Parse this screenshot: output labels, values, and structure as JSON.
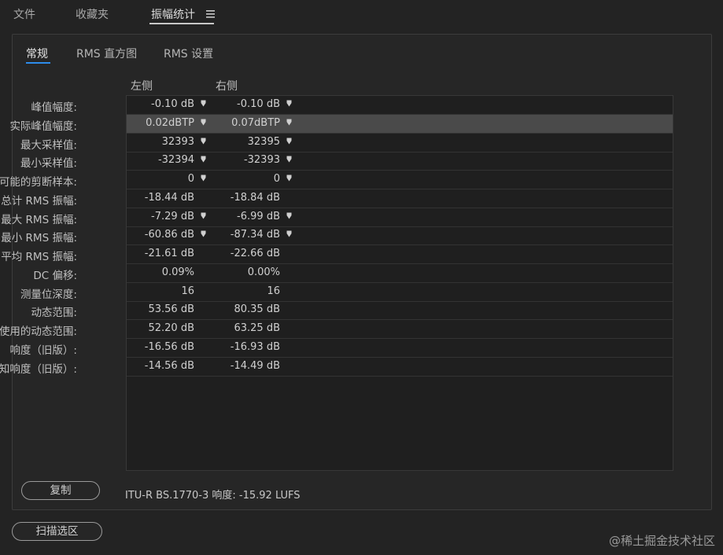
{
  "top_tabs": [
    {
      "label": "文件"
    },
    {
      "label": "收藏夹"
    },
    {
      "label": "振幅统计"
    }
  ],
  "menu_icon": "hamburger-menu-icon",
  "sub_tabs": [
    {
      "label": "常规"
    },
    {
      "label": "RMS 直方图"
    },
    {
      "label": "RMS 设置"
    }
  ],
  "columns": {
    "left": "左侧",
    "right": "右侧"
  },
  "rows": [
    {
      "label": "峰值幅度:",
      "left": "-0.10 dB",
      "right": "-0.10 dB",
      "pin": true
    },
    {
      "label": "实际峰值幅度:",
      "left": "0.02dBTP",
      "right": "0.07dBTP",
      "pin": true,
      "selected": true
    },
    {
      "label": "最大采样值:",
      "left": "32393",
      "right": "32395",
      "pin": true
    },
    {
      "label": "最小采样值:",
      "left": "-32394",
      "right": "-32393",
      "pin": true
    },
    {
      "label": "可能的剪断样本:",
      "left": "0",
      "right": "0",
      "pin": true
    },
    {
      "label": "总计 RMS 振幅:",
      "left": "-18.44 dB",
      "right": "-18.84 dB",
      "pin": false
    },
    {
      "label": "最大 RMS 振幅:",
      "left": "-7.29 dB",
      "right": "-6.99 dB",
      "pin": true
    },
    {
      "label": "最小 RMS 振幅:",
      "left": "-60.86 dB",
      "right": "-87.34 dB",
      "pin": true
    },
    {
      "label": "平均 RMS 振幅:",
      "left": "-21.61 dB",
      "right": "-22.66 dB",
      "pin": false
    },
    {
      "label": "DC 偏移:",
      "left": "0.09%",
      "right": "0.00%",
      "pin": false
    },
    {
      "label": "测量位深度:",
      "left": "16",
      "right": "16",
      "pin": false
    },
    {
      "label": "动态范围:",
      "left": "53.56 dB",
      "right": "80.35 dB",
      "pin": false
    },
    {
      "label": "使用的动态范围:",
      "left": "52.20 dB",
      "right": "63.25 dB",
      "pin": false
    },
    {
      "label": "响度（旧版）:",
      "left": "-16.56 dB",
      "right": "-16.93 dB",
      "pin": false
    },
    {
      "label": "感知响度（旧版）:",
      "left": "-14.56 dB",
      "right": "-14.49 dB",
      "pin": false
    }
  ],
  "copy_button": "复制",
  "itu_text": "ITU-R BS.1770-3 响度:  -15.92 LUFS",
  "scan_button": "扫描选区",
  "watermark": "@稀土掘金技术社区",
  "colors": {
    "background": "#232323",
    "accent_underline": "#2d8ceb",
    "selected_row": "#4a4a4a"
  }
}
